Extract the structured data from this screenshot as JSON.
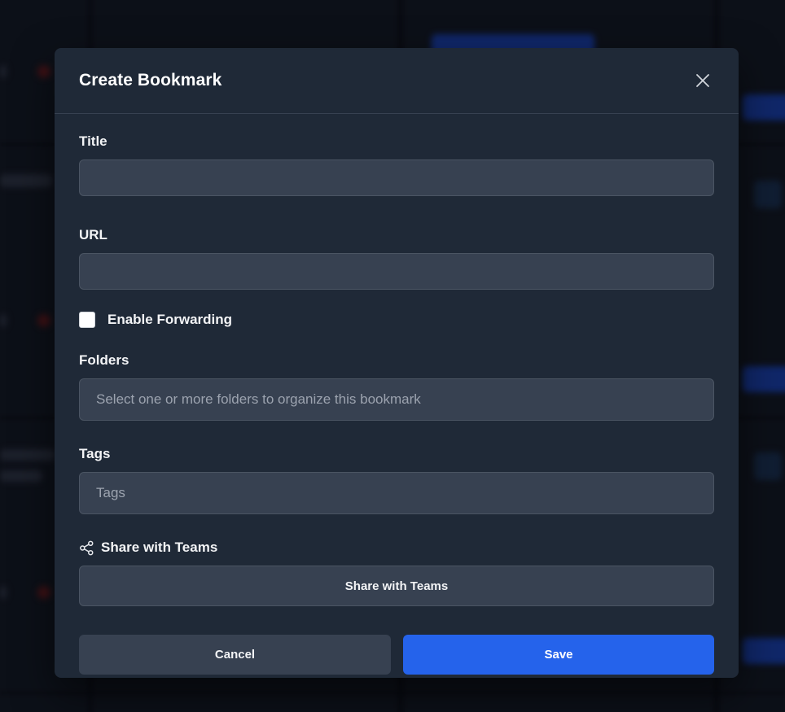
{
  "modal": {
    "title": "Create Bookmark",
    "close_icon": "close-icon"
  },
  "form": {
    "title_label": "Title",
    "title_value": "",
    "url_label": "URL",
    "url_value": "",
    "forwarding_label": "Enable Forwarding",
    "forwarding_checked": false,
    "folders_label": "Folders",
    "folders_placeholder": "Select one or more folders to organize this bookmark",
    "tags_label": "Tags",
    "tags_placeholder": "Tags",
    "share_label": "Share with Teams",
    "share_icon": "share-icon",
    "share_button": "Share with Teams"
  },
  "footer": {
    "cancel_label": "Cancel",
    "save_label": "Save"
  },
  "colors": {
    "modal_bg": "#1f2937",
    "input_bg": "#374151",
    "primary": "#2563eb"
  }
}
